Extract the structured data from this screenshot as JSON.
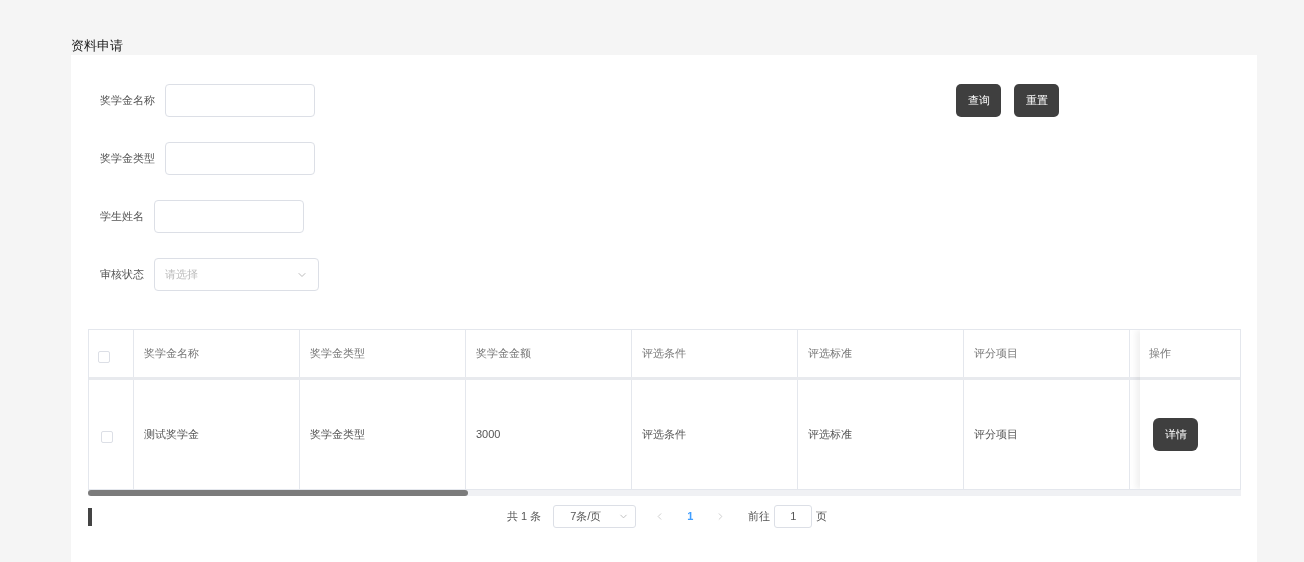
{
  "page_title": "资料申请",
  "filters": [
    {
      "kind": "input",
      "label": "奖学金名称"
    },
    {
      "kind": "input",
      "label": "奖学金类型"
    },
    {
      "kind": "input",
      "label": "学生姓名"
    },
    {
      "kind": "select",
      "label": "审核状态",
      "placeholder": "请选择"
    }
  ],
  "buttons": [
    "查询",
    "重置"
  ],
  "table": {
    "columns": [
      "奖学金名称",
      "奖学金类型",
      "奖学金金额",
      "评选条件",
      "评选标准",
      "评分项目"
    ],
    "action_column": "操作",
    "rows": [
      {
        "checked": false,
        "cells": [
          "测试奖学金",
          "奖学金类型",
          "3000",
          "评选条件",
          "评选标准",
          "评分项目"
        ],
        "action": "详情"
      }
    ],
    "header_checked": false
  },
  "scroll": {
    "level": 0.33
  },
  "pagination": {
    "total": "共 1 条",
    "page_size": "7条/页",
    "pages": [
      {
        "label": "1",
        "selected": true
      }
    ],
    "goto_label": "前往",
    "goto_value": "1",
    "goto_suffix": "页"
  }
}
